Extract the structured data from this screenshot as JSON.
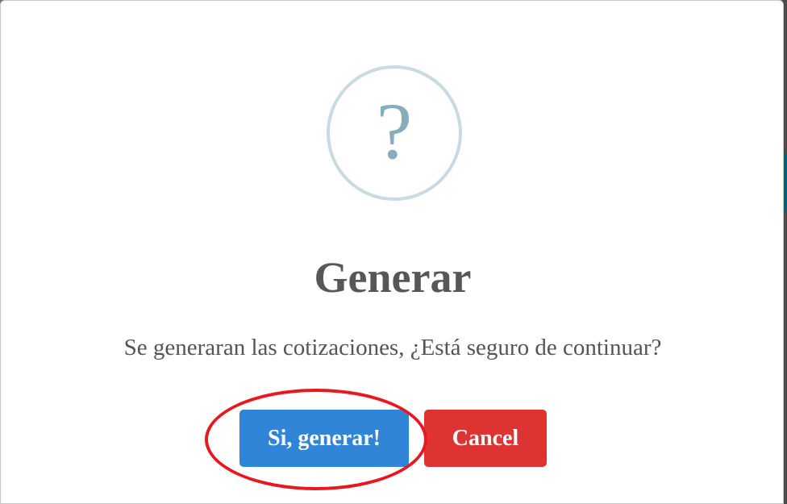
{
  "dialog": {
    "icon": "question-mark-icon",
    "icon_glyph": "?",
    "title": "Generar",
    "message": "Se generaran las cotizaciones, ¿Está seguro de continuar?",
    "confirm_label": "Si, generar!",
    "cancel_label": "Cancel"
  },
  "colors": {
    "confirm": "#3085d6",
    "cancel": "#dd3333",
    "icon_ring": "#c9dae1",
    "icon_glyph": "#87adbd",
    "highlight_annotation": "#e8191e"
  }
}
